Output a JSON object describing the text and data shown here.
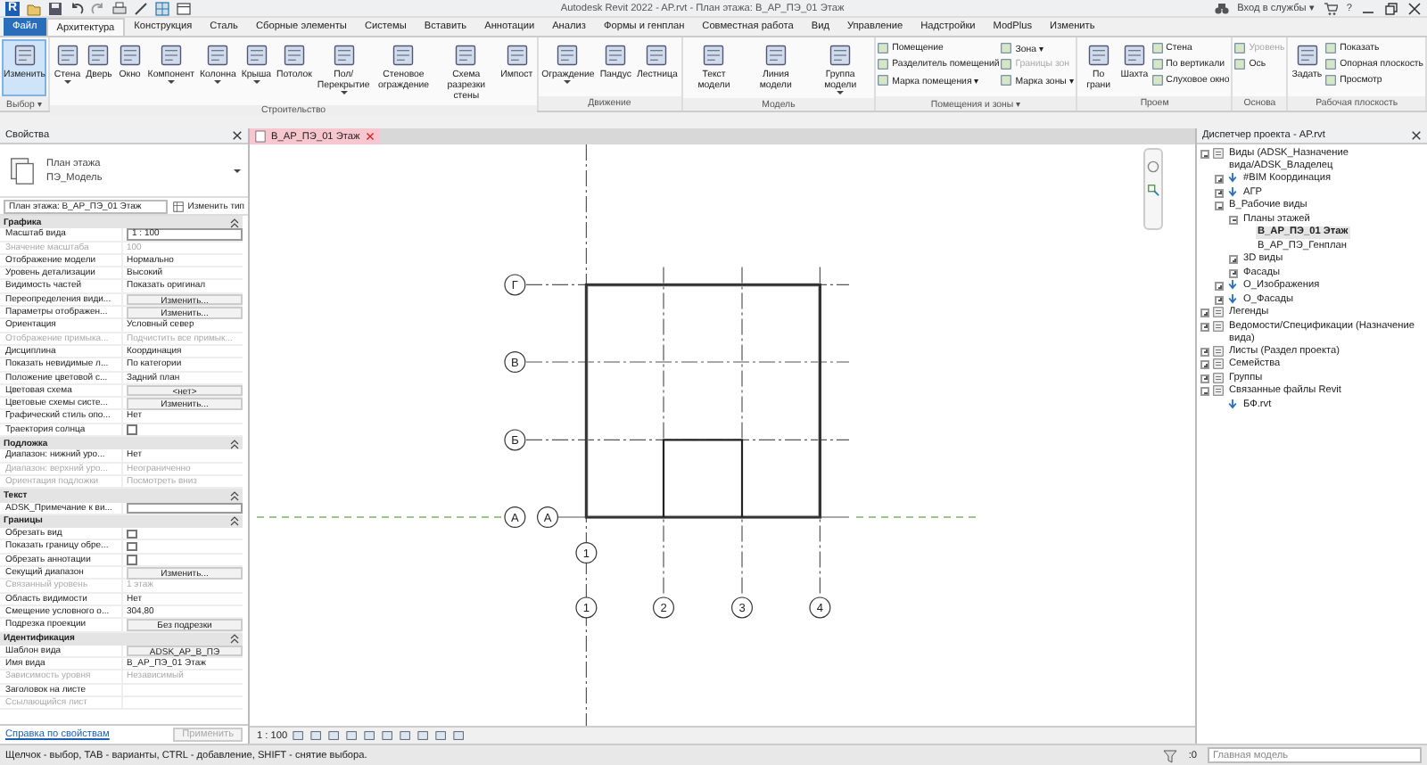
{
  "title_bar": {
    "logo": "R",
    "title": "Autodesk Revit 2022 - AP.rvt - План этажа: В_АР_ПЭ_01 Этаж",
    "sign_in": "Вход в службы ▾",
    "help": "?"
  },
  "tabs": [
    {
      "label": "Файл",
      "kind": "file",
      "selected": false
    },
    {
      "label": "Архитектура",
      "kind": "tab",
      "selected": true
    },
    {
      "label": "Конструкция",
      "kind": "tab",
      "selected": false
    },
    {
      "label": "Сталь",
      "kind": "tab",
      "selected": false
    },
    {
      "label": "Сборные элементы",
      "kind": "tab",
      "selected": false
    },
    {
      "label": "Системы",
      "kind": "tab",
      "selected": false
    },
    {
      "label": "Вставить",
      "kind": "tab",
      "selected": false
    },
    {
      "label": "Аннотации",
      "kind": "tab",
      "selected": false
    },
    {
      "label": "Анализ",
      "kind": "tab",
      "selected": false
    },
    {
      "label": "Формы и генплан",
      "kind": "tab",
      "selected": false
    },
    {
      "label": "Совместная работа",
      "kind": "tab",
      "selected": false
    },
    {
      "label": "Вид",
      "kind": "tab",
      "selected": false
    },
    {
      "label": "Управление",
      "kind": "tab",
      "selected": false
    },
    {
      "label": "Надстройки",
      "kind": "tab",
      "selected": false
    },
    {
      "label": "ModPlus",
      "kind": "tab",
      "selected": false
    },
    {
      "label": "Изменить",
      "kind": "tab",
      "selected": false
    }
  ],
  "ribbon": {
    "panels": [
      {
        "title": "Выбор ▾",
        "items": [
          {
            "kind": "large",
            "label": "Изменить",
            "selected": true,
            "dropdown": false
          }
        ]
      },
      {
        "title": "Строительство",
        "items": [
          {
            "kind": "large",
            "label": "Стена",
            "selected": false,
            "dropdown": true
          },
          {
            "kind": "large",
            "label": "Дверь",
            "selected": false,
            "dropdown": false
          },
          {
            "kind": "large",
            "label": "Окно",
            "selected": false,
            "dropdown": false
          },
          {
            "kind": "large",
            "label": "Компонент",
            "selected": false,
            "dropdown": true
          },
          {
            "kind": "large",
            "label": "Колонна",
            "selected": false,
            "dropdown": true
          },
          {
            "kind": "large",
            "label": "Крыша",
            "selected": false,
            "dropdown": true
          },
          {
            "kind": "large",
            "label": "Потолок",
            "selected": false,
            "dropdown": false
          },
          {
            "kind": "large",
            "label": "Пол/Перекрытие",
            "selected": false,
            "dropdown": true
          },
          {
            "kind": "large",
            "label": "Стеновое ограждение",
            "selected": false,
            "dropdown": false
          },
          {
            "kind": "large",
            "label": "Схема разрезки стены",
            "selected": false,
            "dropdown": false
          },
          {
            "kind": "large",
            "label": "Импост",
            "selected": false,
            "dropdown": false
          }
        ]
      },
      {
        "title": "Движение",
        "items": [
          {
            "kind": "large",
            "label": "Ограждение",
            "selected": false,
            "dropdown": true
          },
          {
            "kind": "large",
            "label": "Пандус",
            "selected": false,
            "dropdown": false
          },
          {
            "kind": "large",
            "label": "Лестница",
            "selected": false,
            "dropdown": false
          }
        ]
      },
      {
        "title": "Модель",
        "items": [
          {
            "kind": "large",
            "label": "Текст модели",
            "selected": false,
            "dropdown": false
          },
          {
            "kind": "large",
            "label": "Линия модели",
            "selected": false,
            "dropdown": false
          },
          {
            "kind": "large",
            "label": "Группа модели",
            "selected": false,
            "dropdown": true
          }
        ]
      },
      {
        "title": "Помещения и зоны ▾",
        "items": [
          {
            "kind": "small",
            "label": "Помещение",
            "disabled": false
          },
          {
            "kind": "small",
            "label": "Разделитель помещений",
            "disabled": false
          },
          {
            "kind": "small",
            "label": "Марка помещения ▾",
            "disabled": false
          },
          {
            "kind": "small",
            "label": "Зона ▾",
            "disabled": false
          },
          {
            "kind": "small",
            "label": "Границы зон",
            "disabled": true
          },
          {
            "kind": "small",
            "label": "Марка зоны ▾",
            "disabled": false
          }
        ]
      },
      {
        "title": "Проем",
        "items": [
          {
            "kind": "large",
            "label": "По грани",
            "selected": false,
            "dropdown": false
          },
          {
            "kind": "large",
            "label": "Шахта",
            "selected": false,
            "dropdown": false
          },
          {
            "kind": "small",
            "label": "Стена",
            "disabled": false
          },
          {
            "kind": "small",
            "label": "По вертикали",
            "disabled": false
          },
          {
            "kind": "small",
            "label": "Слуховое окно",
            "disabled": false
          }
        ]
      },
      {
        "title": "Основа",
        "items": [
          {
            "kind": "small",
            "label": "Уровень",
            "disabled": true
          },
          {
            "kind": "small",
            "label": "Ось",
            "disabled": false
          }
        ]
      },
      {
        "title": "Рабочая плоскость",
        "items": [
          {
            "kind": "large",
            "label": "Задать",
            "selected": false,
            "dropdown": false
          },
          {
            "kind": "small",
            "label": "Показать",
            "disabled": false
          },
          {
            "kind": "small",
            "label": "Опорная плоскость",
            "disabled": false
          },
          {
            "kind": "small",
            "label": "Просмотр",
            "disabled": false
          }
        ]
      }
    ]
  },
  "properties": {
    "title": "Свойства",
    "type_name": "План этажа",
    "type_value": "ПЭ_Модель",
    "instance_selector": "План этажа: В_АР_ПЭ_01 Этаж",
    "edit_type": "Изменить тип",
    "sections": [
      {
        "title": "Графика",
        "rows": [
          {
            "label": "Масштаб вида",
            "kind": "input",
            "value": "1 : 100",
            "disabled": false
          },
          {
            "label": "Значение масштаба",
            "kind": "text",
            "value": "100",
            "disabled": true
          },
          {
            "label": "Отображение модели",
            "kind": "text",
            "value": "Нормально",
            "disabled": false
          },
          {
            "label": "Уровень детализации",
            "kind": "text",
            "value": "Высокий",
            "disabled": false
          },
          {
            "label": "Видимость частей",
            "kind": "text",
            "value": "Показать оригинал",
            "disabled": false
          },
          {
            "label": "Переопределения види...",
            "kind": "button",
            "value": "Изменить...",
            "disabled": false
          },
          {
            "label": "Параметры отображен...",
            "kind": "button",
            "value": "Изменить...",
            "disabled": false
          },
          {
            "label": "Ориентация",
            "kind": "text",
            "value": "Условный север",
            "disabled": false
          },
          {
            "label": "Отображение примыка...",
            "kind": "text",
            "value": "Подчистить все примык...",
            "disabled": true
          },
          {
            "label": "Дисциплина",
            "kind": "text",
            "value": "Координация",
            "disabled": false
          },
          {
            "label": "Показать невидимые л...",
            "kind": "text",
            "value": "По категории",
            "disabled": false
          },
          {
            "label": "Положение цветовой с...",
            "kind": "text",
            "value": "Задний план",
            "disabled": false
          },
          {
            "label": "Цветовая схема",
            "kind": "button",
            "value": "<нет>",
            "disabled": false
          },
          {
            "label": "Цветовые схемы систе...",
            "kind": "button",
            "value": "Изменить...",
            "disabled": false
          },
          {
            "label": "Графический стиль опо...",
            "kind": "text",
            "value": "Нет",
            "disabled": false
          },
          {
            "label": "Траектория солнца",
            "kind": "checkbox",
            "checked": false,
            "disabled": false
          }
        ]
      },
      {
        "title": "Подложка",
        "rows": [
          {
            "label": "Диапазон: нижний уро...",
            "kind": "text",
            "value": "Нет",
            "disabled": false
          },
          {
            "label": "Диапазон: верхний уро...",
            "kind": "text",
            "value": "Неограниченно",
            "disabled": true
          },
          {
            "label": "Ориентация подложки",
            "kind": "text",
            "value": "Посмотреть вниз",
            "disabled": true
          }
        ]
      },
      {
        "title": "Текст",
        "rows": [
          {
            "label": "ADSK_Примечание к ви...",
            "kind": "input",
            "disabled": false
          }
        ]
      },
      {
        "title": "Границы",
        "rows": [
          {
            "label": "Обрезать вид",
            "kind": "checkbox",
            "checked": false,
            "disabled": false
          },
          {
            "label": "Показать границу обре...",
            "kind": "checkbox",
            "checked": false,
            "disabled": false
          },
          {
            "label": "Обрезать аннотации",
            "kind": "checkbox",
            "checked": false,
            "disabled": false
          },
          {
            "label": "Секущий диапазон",
            "kind": "button",
            "value": "Изменить...",
            "disabled": false
          },
          {
            "label": "Связанный уровень",
            "kind": "text",
            "value": "1 этаж",
            "disabled": true
          },
          {
            "label": "Область видимости",
            "kind": "text",
            "value": "Нет",
            "disabled": false
          },
          {
            "label": "Смещение условного о...",
            "kind": "text",
            "value": "304,80",
            "disabled": false
          },
          {
            "label": "Подрезка проекции",
            "kind": "button",
            "value": "Без подрезки",
            "disabled": false
          }
        ]
      },
      {
        "title": "Идентификация",
        "rows": [
          {
            "label": "Шаблон вида",
            "kind": "button",
            "value": "ADSK_АР_В_ПЭ",
            "disabled": false
          },
          {
            "label": "Имя вида",
            "kind": "text",
            "value": "В_АР_ПЭ_01 Этаж",
            "disabled": false
          },
          {
            "label": "Зависимость уровня",
            "kind": "text",
            "value": "Независимый",
            "disabled": true
          },
          {
            "label": "Заголовок на листе",
            "kind": "text",
            "disabled": false
          },
          {
            "label": "Ссылающийся лист",
            "kind": "text",
            "disabled": true
          }
        ]
      }
    ],
    "help_link": "Справка по свойствам",
    "apply": "Применить",
    "apply_disabled": true
  },
  "view": {
    "tab": "В_АР_ПЭ_01 Этаж",
    "scale": "1 : 100",
    "drawing": {
      "row_axes": [
        "Г",
        "В",
        "Б",
        "А"
      ],
      "extra_row_bubble": "А",
      "column_axes": [
        "1",
        "2",
        "3",
        "4"
      ],
      "extra_column_bubble": "1"
    }
  },
  "project_browser": {
    "title": "Диспетчер проекта - AP.rvt",
    "tree": [
      {
        "label": "Виды (ADSK_Назначение вида/ADSK_Владелец",
        "expanded": true,
        "selected": false,
        "children": [
          {
            "label": "#BIM Координация",
            "expanded": false,
            "selected": false
          },
          {
            "label": "АГР",
            "expanded": false,
            "selected": false
          },
          {
            "label": "В_Рабочие виды",
            "expanded": true,
            "selected": false,
            "children": [
              {
                "label": "Планы этажей",
                "expanded": true,
                "selected": false,
                "children": [
                  {
                    "label": "В_АР_ПЭ_01 Этаж",
                    "selected": true
                  },
                  {
                    "label": "В_АР_ПЭ_Генплан",
                    "selected": false
                  }
                ]
              },
              {
                "label": "3D виды",
                "expanded": false,
                "selected": false
              },
              {
                "label": "Фасады",
                "expanded": false,
                "selected": false
              }
            ]
          },
          {
            "label": "О_Изображения",
            "expanded": false,
            "selected": false
          },
          {
            "label": "О_Фасады",
            "expanded": false,
            "selected": false
          }
        ]
      },
      {
        "label": "Легенды",
        "expanded": false,
        "selected": false
      },
      {
        "label": "Ведомости/Спецификации (Назначение вида)",
        "expanded": false,
        "selected": false
      },
      {
        "label": "Листы (Раздел проекта)",
        "expanded": false,
        "selected": false
      },
      {
        "label": "Семейства",
        "expanded": false,
        "selected": false
      },
      {
        "label": "Группы",
        "expanded": false,
        "selected": false
      },
      {
        "label": "Связанные файлы Revit",
        "expanded": true,
        "selected": false,
        "children": [
          {
            "label": "БФ.rvt",
            "selected": false
          }
        ]
      }
    ]
  },
  "status_bar": {
    "text": "Щелчок - выбор, TAB - варианты, CTRL - добавление, SHIFT - снятие выбора.",
    "filter_count": ":0",
    "model": "Главная модель"
  }
}
